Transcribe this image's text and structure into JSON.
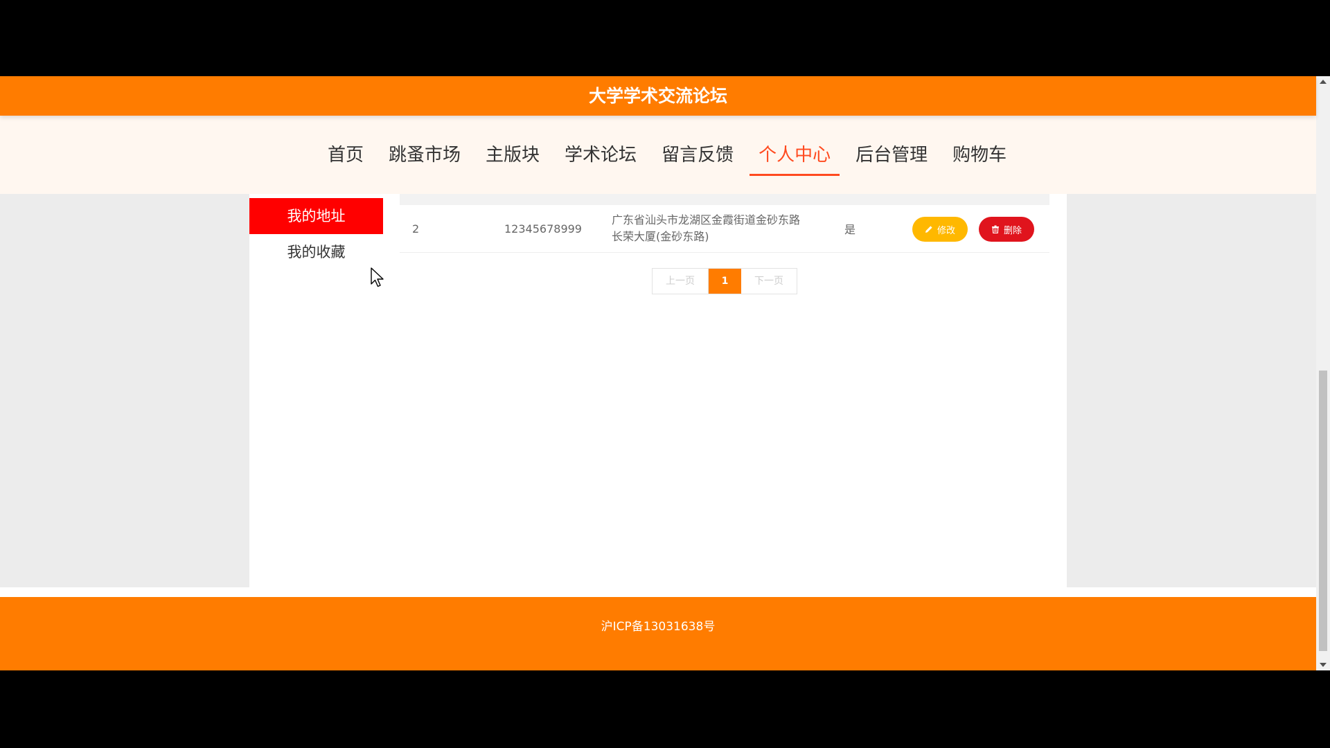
{
  "header": {
    "title": "大学学术交流论坛"
  },
  "nav": {
    "items": [
      {
        "label": "首页"
      },
      {
        "label": "跳蚤市场"
      },
      {
        "label": "主版块"
      },
      {
        "label": "学术论坛"
      },
      {
        "label": "留言反馈"
      },
      {
        "label": "个人中心",
        "active": true
      },
      {
        "label": "后台管理"
      },
      {
        "label": "购物车"
      }
    ]
  },
  "sidebar": {
    "items": [
      {
        "label": "我的地址",
        "active": true
      },
      {
        "label": "我的收藏"
      }
    ]
  },
  "table": {
    "rows": [
      {
        "id": "2",
        "phone": "12345678999",
        "address_line1": "广东省汕头市龙湖区金霞街道金砂东路",
        "address_line2": "长荣大厦(金砂东路)",
        "is_default": "是",
        "edit_label": "修改",
        "delete_label": "删除"
      }
    ]
  },
  "pagination": {
    "prev": "上一页",
    "current": "1",
    "next": "下一页"
  },
  "footer": {
    "icp": "沪ICP备13031638号"
  },
  "colors": {
    "brand_orange": "#ff7c00",
    "active_nav": "#ff4a1f",
    "sidebar_active": "#ff0000",
    "edit_button": "#ffb800",
    "delete_button": "#e0141d"
  }
}
